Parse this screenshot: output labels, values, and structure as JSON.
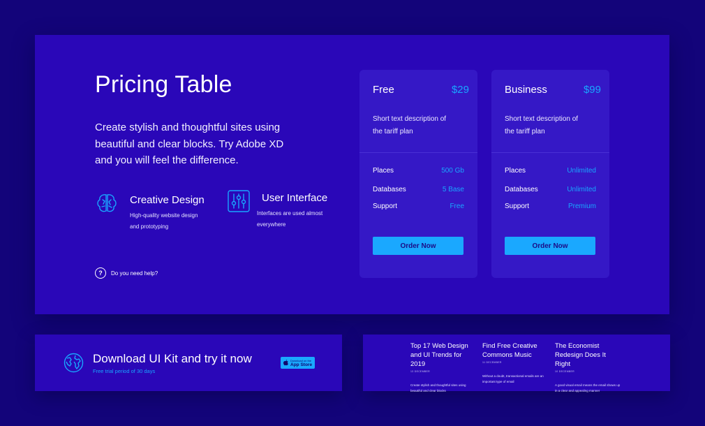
{
  "hero": {
    "title": "Pricing Table",
    "description": "Create stylish and thoughtful sites using beautiful and clear blocks. Try Adobe XD and you will feel the difference.",
    "features": [
      {
        "icon": "brain-icon",
        "title": "Creative Design",
        "description": "High-quality website design and prototyping"
      },
      {
        "icon": "sliders-icon",
        "title": "User Interface",
        "description": "Interfaces are used almost everywhere"
      }
    ],
    "help_icon": "?",
    "help_text": "Do you need help?"
  },
  "plans": [
    {
      "name": "Free",
      "price": "$29",
      "description": "Short text description of the tariff plan",
      "rows": [
        {
          "label": "Places",
          "value": "500 Gb"
        },
        {
          "label": "Databases",
          "value": "5 Base"
        },
        {
          "label": "Support",
          "value": "Free"
        }
      ],
      "button": "Order Now"
    },
    {
      "name": "Business",
      "price": "$99",
      "description": "Short text description of the tariff plan",
      "rows": [
        {
          "label": "Places",
          "value": "Unlimited"
        },
        {
          "label": "Databases",
          "value": "Unlimited"
        },
        {
          "label": "Support",
          "value": "Premium"
        }
      ],
      "button": "Order Now"
    }
  ],
  "download": {
    "icon": "globe-icon",
    "title": "Download UI Kit and try it now",
    "subtitle": "Free trial period of 30 days",
    "store_line1": "Download on the",
    "store_line2": "App Store"
  },
  "blog": [
    {
      "title": "Top 17 Web Design and UI Trends for 2019",
      "date": "13 DECEMBER",
      "text": "Create stylish and thoughtful sites using beautiful and clear blocks"
    },
    {
      "title": "Find Free Creative Commons Music",
      "date": "11 DECEMBER",
      "text": "Without a doubt, transactional emails are an important type of email"
    },
    {
      "title": "The Economist Redesign Does It Right",
      "date": "10 DECEMBER",
      "text": "A good visual email means the email shows up in a clear and appealing manner"
    }
  ],
  "colors": {
    "background": "#13047a",
    "panel": "#2a07b8",
    "card": "#3518c6",
    "accent": "#1aa8ff"
  }
}
